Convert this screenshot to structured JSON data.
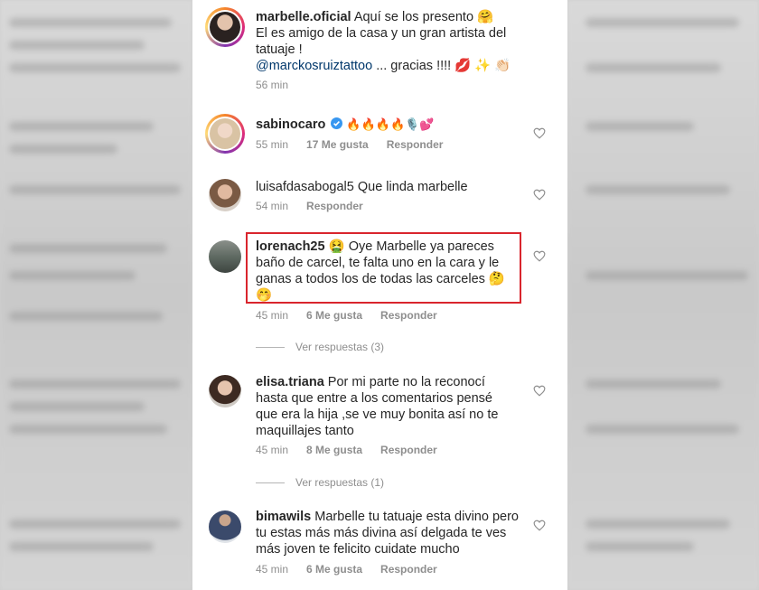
{
  "comments": [
    {
      "username": "marbelle.oficial",
      "text_line1": "Aquí se los presento 🤗",
      "text_line2": "El es amigo de la casa y un gran artista del tatuaje !",
      "mention": "@marckosruiztattoo",
      "text_after_mention": "... gracias !!!! 💋 ✨ 👏🏻",
      "time": "56 min"
    },
    {
      "username": "sabinocaro",
      "verified": true,
      "text": "🔥🔥🔥🔥🎙️💕",
      "time": "55 min",
      "likes": "17 Me gusta",
      "reply": "Responder"
    },
    {
      "username": "luisafdasabogal5",
      "text": "Que linda marbelle",
      "time": "54 min",
      "reply": "Responder"
    },
    {
      "username": "lorenach25",
      "text": "🤮 Oye Marbelle ya pareces baño de carcel, te falta uno en la cara y le ganas a todos los de todas las carceles 🤔 🤭",
      "time": "45 min",
      "likes": "6 Me gusta",
      "reply": "Responder",
      "view_replies": "Ver respuestas (3)"
    },
    {
      "username": "elisa.triana",
      "text": "Por mi parte no la reconocí hasta que entre a los comentarios pensé que era la hija ,se ve muy bonita así no te maquillajes tanto",
      "time": "45 min",
      "likes": "8 Me gusta",
      "reply": "Responder",
      "view_replies": "Ver respuestas (1)"
    },
    {
      "username": "bimawils",
      "text": "Marbelle tu tatuaje esta divino pero tu estas más más divina así delgada te ves más joven te felicito cuidate mucho",
      "time": "45 min",
      "likes": "6 Me gusta",
      "reply": "Responder"
    }
  ],
  "colors": {
    "highlight_border": "#d9252d",
    "mention": "#00376b",
    "meta": "#8e8e8e",
    "verified": "#3897f0"
  }
}
